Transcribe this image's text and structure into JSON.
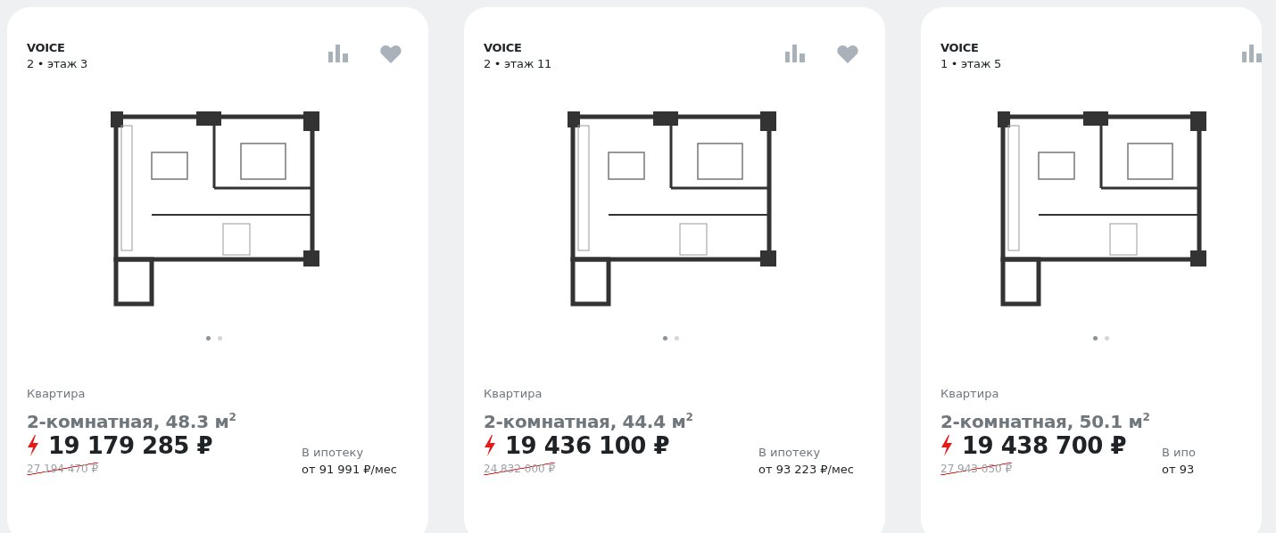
{
  "cards": [
    {
      "project": "VOICE",
      "subtitle": "2 • этаж 3",
      "actions": [
        {
          "kind": "compare"
        },
        {
          "kind": "favorite"
        }
      ],
      "plan": {
        "kind": "picture"
      },
      "slides": [
        {
          "selected": true
        },
        {
          "selected": false
        }
      ],
      "type": "Квартира",
      "title": "2-комнатная, 48.3 м$^{2}$",
      "price": "19 179 285 ₽",
      "old_price": "27 194 470 ₽",
      "mortgage_label": "В ипотеку",
      "mortgage_value": "от 91 991 ₽/мес"
    },
    {
      "project": "VOICE",
      "subtitle": "2 • этаж 11",
      "actions": [
        {
          "kind": "compare"
        },
        {
          "kind": "favorite"
        }
      ],
      "plan": {
        "kind": "picture"
      },
      "slides": [
        {
          "selected": true
        },
        {
          "selected": false
        }
      ],
      "type": "Квартира",
      "title": "2-комнатная, 44.4 м$^{2}$",
      "price": "19 436 100 ₽",
      "old_price": "24 832 000 ₽",
      "mortgage_label": "В ипотеку",
      "mortgage_value": "от 93 223 ₽/мес"
    },
    {
      "project": "VOICE",
      "subtitle": "1 • этаж 5",
      "actions": [
        {
          "kind": "compare"
        }
      ],
      "plan": {
        "kind": "picture"
      },
      "slides": [
        {
          "selected": true
        },
        {
          "selected": false
        }
      ],
      "type": "Квартира",
      "title": "2-комнатная, 50.1 м$^{2}$",
      "price": "19 438 700 ₽",
      "old_price": "27 943 050 ₽",
      "mortgage_label": "В ипо",
      "mortgage_value": "от 93"
    }
  ]
}
